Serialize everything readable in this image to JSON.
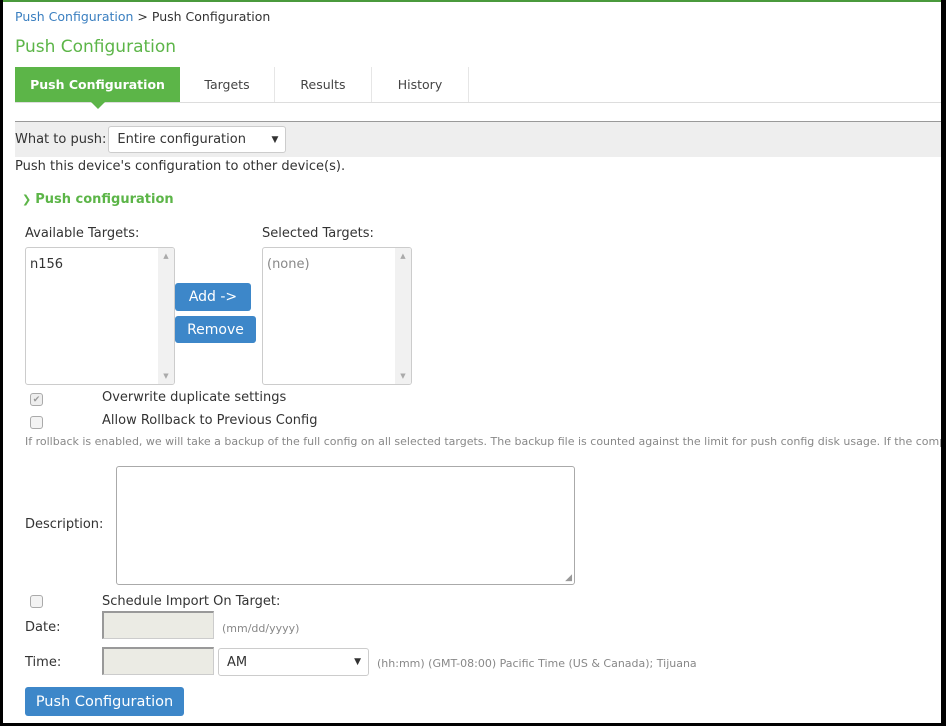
{
  "breadcrumb": {
    "parent": "Push Configuration",
    "separator": ">",
    "current": "Push Configuration"
  },
  "page_title": "Push Configuration",
  "tabs": [
    {
      "label": "Push Configuration",
      "active": true
    },
    {
      "label": "Targets",
      "active": false
    },
    {
      "label": "Results",
      "active": false
    },
    {
      "label": "History",
      "active": false
    }
  ],
  "what_to_push": {
    "label": "What to push:",
    "selected": "Entire configuration"
  },
  "intro_text": "Push this device's configuration to other device(s).",
  "section": {
    "title": "Push configuration",
    "icon": "chevron-down-icon"
  },
  "available_targets": {
    "label": "Available Targets:",
    "items": [
      "n156"
    ]
  },
  "selected_targets": {
    "label": "Selected Targets:",
    "placeholder": "(none)"
  },
  "buttons": {
    "add": "Add ->",
    "remove": "Remove",
    "push": "Push Configuration"
  },
  "options": {
    "overwrite": {
      "label": "Overwrite duplicate settings",
      "checked": true,
      "disabled": true
    },
    "rollback": {
      "label": "Allow Rollback to Previous Config",
      "checked": false
    }
  },
  "rollback_note": "If rollback is enabled, we will take a backup of the full config on all selected targets. The backup file is counted against the limit for push config disk usage. If the complete.",
  "description": {
    "label": "Description:",
    "value": ""
  },
  "schedule": {
    "label": "Schedule Import On Target:",
    "checked": false,
    "date_label": "Date:",
    "date_value": "",
    "date_hint": "(mm/dd/yyyy)",
    "time_label": "Time:",
    "time_value": "",
    "ampm_selected": "AM",
    "time_hint": "(hh:mm)  (GMT-08:00) Pacific Time (US & Canada); Tijuana"
  },
  "colors": {
    "accent_green": "#5cb548",
    "button_blue": "#3d87c9",
    "link_blue": "#3a7fc0"
  }
}
